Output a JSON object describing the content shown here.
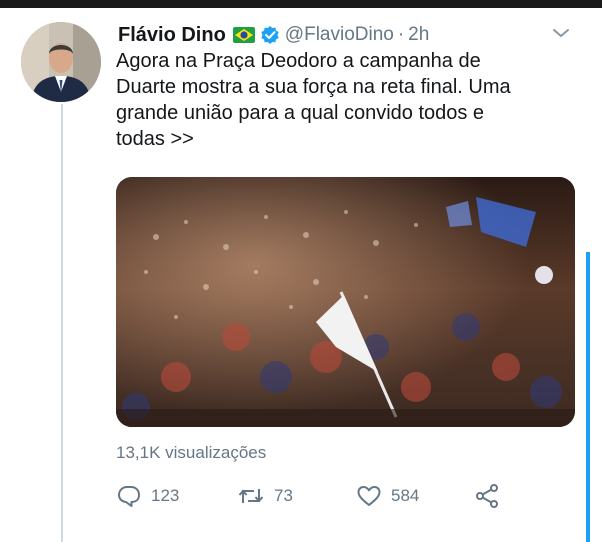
{
  "tweet": {
    "author_name": "Flávio Dino",
    "handle": "@FlavioDino",
    "separator": "·",
    "time": "2h",
    "text_lines": [
      "Agora na Praça Deodoro a campanha de",
      "Duarte mostra a sua força na reta final. Uma",
      "grande união para a qual convido todos e",
      "todas >>"
    ],
    "views": "13,1K visualizações"
  },
  "actions": {
    "replies": "123",
    "retweets": "73",
    "likes": "584"
  },
  "icons": {
    "flag": "brazil-flag-emoji",
    "verified": "verified-badge-icon",
    "menu": "chevron-down-icon",
    "reply": "reply-icon",
    "retweet": "retweet-icon",
    "like": "heart-icon",
    "share": "share-icon"
  },
  "colors": {
    "accent": "#1da1f2",
    "secondary_text": "#657786",
    "primary_text": "#14171a"
  }
}
